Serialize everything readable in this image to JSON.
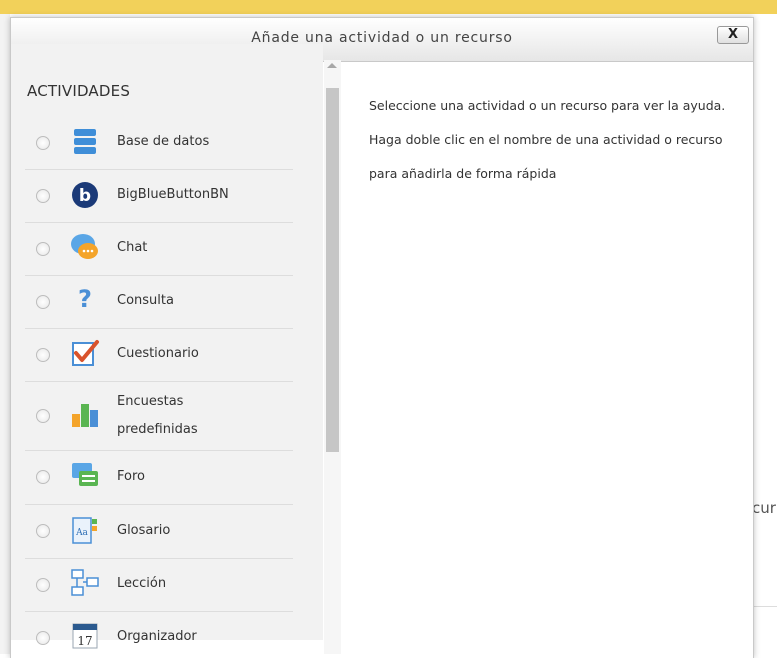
{
  "dialog": {
    "title": "Añade una actividad o un recurso",
    "close_label": "X"
  },
  "section": {
    "title": "ACTIVIDADES"
  },
  "options": [
    {
      "label": "Base de datos",
      "icon": "database-icon"
    },
    {
      "label": "BigBlueButtonBN",
      "icon": "bigbluebutton-icon"
    },
    {
      "label": "Chat",
      "icon": "chat-icon"
    },
    {
      "label": "Consulta",
      "icon": "question-mark-icon"
    },
    {
      "label": "Cuestionario",
      "icon": "quiz-checkmark-icon"
    },
    {
      "label_line1": "Encuestas",
      "label_line2": "predefinidas",
      "icon": "bar-chart-icon"
    },
    {
      "label": "Foro",
      "icon": "forum-icon"
    },
    {
      "label": "Glosario",
      "icon": "glossary-icon"
    },
    {
      "label": "Lección",
      "icon": "lesson-flowchart-icon"
    },
    {
      "label": "Organizador",
      "icon": "calendar-icon",
      "icon_text": "17"
    }
  ],
  "help": {
    "text": "Seleccione una actividad o un recurso para ver la ayuda. Haga doble clic en el nombre de una actividad o recurso para añadirla de forma rápida"
  },
  "background": {
    "partial_text": "cur"
  }
}
